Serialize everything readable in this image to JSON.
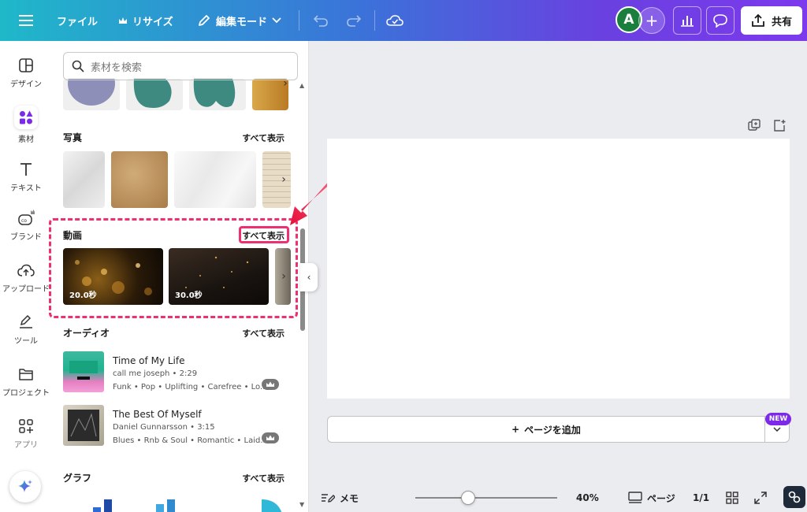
{
  "topbar": {
    "file_label": "ファイル",
    "resize_label": "リサイズ",
    "edit_mode_label": "編集モード",
    "avatar_letter": "A",
    "share_label": "共有"
  },
  "rail": {
    "items": [
      {
        "label": "デザイン",
        "icon": "layout-icon"
      },
      {
        "label": "素材",
        "icon": "elements-icon"
      },
      {
        "label": "テキスト",
        "icon": "text-icon"
      },
      {
        "label": "ブランド",
        "icon": "brand-icon"
      },
      {
        "label": "アップロード",
        "icon": "upload-icon"
      },
      {
        "label": "ツール",
        "icon": "draw-icon"
      },
      {
        "label": "プロジェクト",
        "icon": "folder-icon"
      },
      {
        "label": "アプリ",
        "icon": "apps-icon"
      }
    ]
  },
  "panel": {
    "search_placeholder": "素材を検索",
    "show_all": "すべて表示",
    "sections": {
      "photos": "写真",
      "videos": "動画",
      "audio": "オーディオ",
      "graphs": "グラフ"
    },
    "videos": [
      {
        "duration": "20.0秒"
      },
      {
        "duration": "30.0秒"
      }
    ],
    "tracks": [
      {
        "title": "Time of My Life",
        "meta": "call me joseph • 2:29",
        "tags": "Funk • Pop • Uplifting • Carefree • Lo..."
      },
      {
        "title": "The Best Of Myself",
        "meta": "Daniel Gunnarsson • 3:15",
        "tags": "Blues • Rnb & Soul • Romantic • Laid..."
      }
    ]
  },
  "canvas": {
    "add_page_label": "ページを追加",
    "new_badge": "NEW"
  },
  "bottombar": {
    "notes_label": "メモ",
    "zoom_label": "40%",
    "zoom_value": 0.4,
    "pages_label": "ページ",
    "page_count": "1/1"
  },
  "colors": {
    "highlight": "#ee2f72",
    "accent": "#7d2ae8",
    "avatar_bg": "#1a7f3c"
  }
}
